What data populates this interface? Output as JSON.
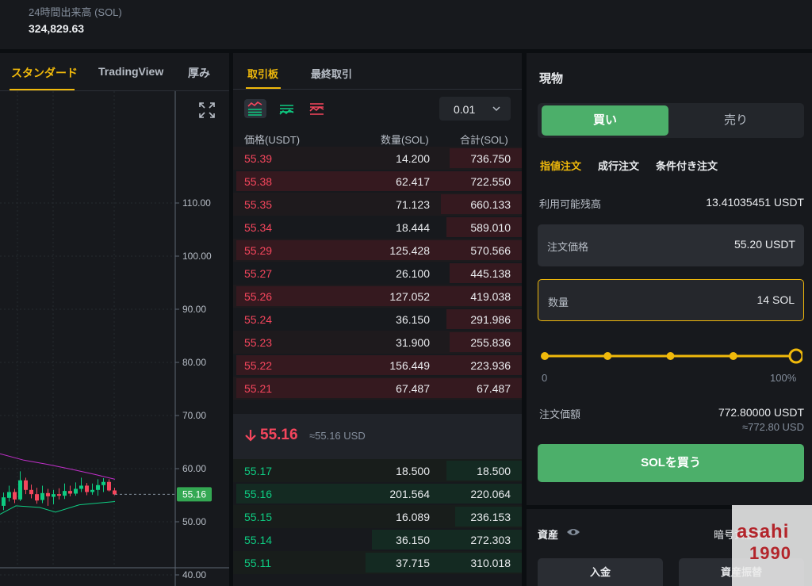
{
  "stats": {
    "label": "24時間出来高 (SOL)",
    "value": "324,829.63"
  },
  "chart": {
    "tabs": [
      "スタンダード",
      "TradingView",
      "厚み"
    ],
    "active_tab": 0,
    "y_ticks": [
      "110.00",
      "100.00",
      "90.00",
      "80.00",
      "70.00",
      "60.00",
      "50.00",
      "40.00"
    ],
    "y_range": [
      40,
      110
    ],
    "last_price": "55.16",
    "colors": {
      "up": "#0ecb81",
      "down": "#f6465d",
      "ma1": "#c02fc9",
      "ma2": "#0ecb81",
      "label_bg": "#34a853"
    }
  },
  "orderbook": {
    "tabs": [
      "取引板",
      "最終取引"
    ],
    "precision": "0.01",
    "headers": {
      "price": "価格(USDT)",
      "qty": "数量(SOL)",
      "total": "合計(SOL)"
    },
    "asks": [
      {
        "p": "55.39",
        "q": "14.200",
        "t": "736.750",
        "d": 0.25
      },
      {
        "p": "55.38",
        "q": "62.417",
        "t": "722.550",
        "d": 0.99
      },
      {
        "p": "55.35",
        "q": "71.123",
        "t": "660.133",
        "d": 0.28
      },
      {
        "p": "55.34",
        "q": "18.444",
        "t": "589.010",
        "d": 0.26
      },
      {
        "p": "55.29",
        "q": "125.428",
        "t": "570.566",
        "d": 0.99
      },
      {
        "p": "55.27",
        "q": "26.100",
        "t": "445.138",
        "d": 0.25
      },
      {
        "p": "55.26",
        "q": "127.052",
        "t": "419.038",
        "d": 0.99
      },
      {
        "p": "55.24",
        "q": "36.150",
        "t": "291.986",
        "d": 0.26
      },
      {
        "p": "55.23",
        "q": "31.900",
        "t": "255.836",
        "d": 0.25
      },
      {
        "p": "55.22",
        "q": "156.449",
        "t": "223.936",
        "d": 0.99
      },
      {
        "p": "55.21",
        "q": "67.487",
        "t": "67.487",
        "d": 0.99
      }
    ],
    "mid": {
      "price": "55.16",
      "usd": "≈55.16 USD"
    },
    "bids": [
      {
        "p": "55.17",
        "q": "18.500",
        "t": "18.500",
        "d": 0.26
      },
      {
        "p": "55.16",
        "q": "201.564",
        "t": "220.064",
        "d": 0.99
      },
      {
        "p": "55.15",
        "q": "16.089",
        "t": "236.153",
        "d": 0.23
      },
      {
        "p": "55.14",
        "q": "36.150",
        "t": "272.303",
        "d": 0.52
      },
      {
        "p": "55.11",
        "q": "37.715",
        "t": "310.018",
        "d": 0.54
      }
    ]
  },
  "trade": {
    "title": "現物",
    "buy_tab": "買い",
    "sell_tab": "売り",
    "order_types": [
      "指値注文",
      "成行注文",
      "条件付き注文"
    ],
    "available_label": "利用可能残高",
    "available_value": "13.41035451 USDT",
    "price_label": "注文価格",
    "price_value": "55.20 USDT",
    "qty_label": "数量",
    "qty_value": "14 SOL",
    "slider_min": "0",
    "slider_max": "100%",
    "slider_fraction": 1.0,
    "amount_label": "注文価額",
    "amount_value": "772.80000 USDT",
    "amount_approx": "≈772.80 USD",
    "buy_button": "SOLを買う"
  },
  "assets": {
    "title": "資産",
    "link": "暗号資産を購入",
    "deposit": "入金",
    "transfer": "資産振替"
  },
  "watermark": {
    "line1": "asahi",
    "line2": "1990"
  }
}
